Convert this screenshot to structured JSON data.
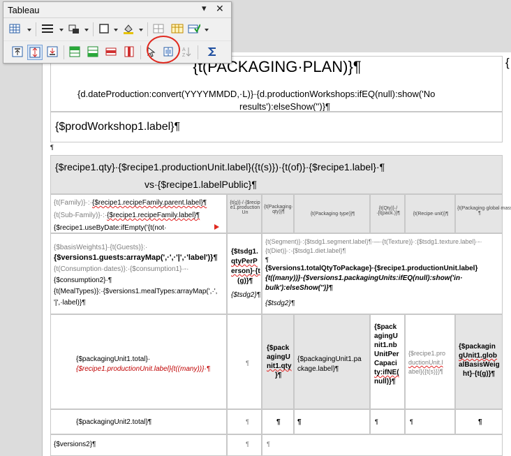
{
  "toolbar": {
    "title": "Tableau",
    "menu_glyph": "▾",
    "close_glyph": "✕"
  },
  "document": {
    "bracket": "{",
    "title": "{t(PACKAGING·PLAN)}¶",
    "subtitle_line1": "{d.dateProduction:convert(YYYYMMDD,·L)}·{d.productionWorkshops:ifEQ(null):show('No",
    "subtitle_line2": "results'):elseShow('')}¶",
    "workshop_label": "{$prodWorkshop1.label}¶",
    "pilcrow": "¶",
    "recipe_line1": "{$recipe1.qty}·{$recipe1.productionUnit.label}({t(s)})·{t(of)}·{$recipe1.label}·¶",
    "recipe_line2": "vs·{$recipe1.labelPublic}¶",
    "family_col": {
      "l1_gray": "{t(Family)}·:·",
      "l1_black": "{$recipe1.recipeFamily.parent.label}¶",
      "l2_gray": "{t(Sub-Family)}·:·",
      "l2_black": "{$recipe1.recipeFamily.label}¶",
      "l3": "{$recipe1.useByDate:ifEmpty('{t(not·"
    },
    "headers": {
      "h1": "{t(g)}·/·{$recipe1.productionUn",
      "h2": "{t(Packaging·qty)}¶",
      "h3": "{t(Packaging·type)}¶",
      "h4": "{t(Qty)}·/·{t(pack.)}¶",
      "h5": "{t(Recipe·unit)}¶",
      "h6": "{t(Packaging·global·mass)}¶"
    },
    "guests_col": {
      "l1": "{$basisWeights1}·{t(Guests)}:·",
      "l2": "{$versions1.guests:arrayMap(',·',·'|',·'label')}¶",
      "l3": "{t(Consumption·dates)}:·{$consumption1}·-·",
      "l4": "{$consumption2}·¶",
      "l5": "{t(MealTypes)}:·{$versions1.mealTypes:arrayMap(',·',",
      "l6": "'|',·label)}¶"
    },
    "tsdg_col": {
      "l1": "{$tsdg1.",
      "l2": "qtyPerP",
      "l3": "erson}·{t",
      "l4": "(g)}¶",
      "l5": "{$tsdg2}¶"
    },
    "segment_col": {
      "l1": "{t(Segment)}·:{$tsdg1.segment.label}¶·—·{t(Texture)}·:{$tsdg1.texture.label}·-·",
      "l2": "{t(Diet)}·:·{$tsdg1.diet.label}¶",
      "l3": "¶",
      "l4": "{$versions1.totalQtyToPackage}·{$recipe1.productionUnit.label}",
      "l5": "{t((many))}·{$versions1.packagingUnits:ifEQ(null):show('in·",
      "l6": "bulk'):elseShow('')}¶",
      "l7": "{$tsdg2}¶"
    },
    "pkg_row": {
      "total_line1": "{$packagingUnit1.total}·",
      "total_line2": "{$recipe1.productionUnit.label}{t((many))}·¶",
      "c2": "¶",
      "c3_l1": "{$pack",
      "c3_l2": "agingU",
      "c3_l3": "nit1.qty",
      "c3_l4": "}¶",
      "c4": "{$packagingUnit1.pa",
      "c4_l2": "ckage.label}¶",
      "c5_l1": "{$pack",
      "c5_l2": "agingU",
      "c5_l3": "nit1.nb",
      "c5_l4": "UnitPer",
      "c5_l5": "Capaci",
      "c5_l6": "ty:ifNE(",
      "c5_l7": "null)}¶",
      "c6_l1": "{$recipe1.pro",
      "c6_l2": "ductionUnit.l",
      "c6_l3": "abel}({t(s)})¶",
      "c7_l1": "{$packagin",
      "c7_l2": "gUnit1.glob",
      "c7_l3": "alBasisWeig",
      "c7_l4": "ht}·{t(g)}¶"
    },
    "pkg2_row": {
      "label": "{$packagingUnit2.total}¶",
      "p": "¶"
    },
    "versions2": "{$versions2}¶"
  },
  "colors": {
    "accent_red": "#e0281e",
    "gray_text": "#7f7f7f",
    "shade": "#e5e5e5"
  }
}
